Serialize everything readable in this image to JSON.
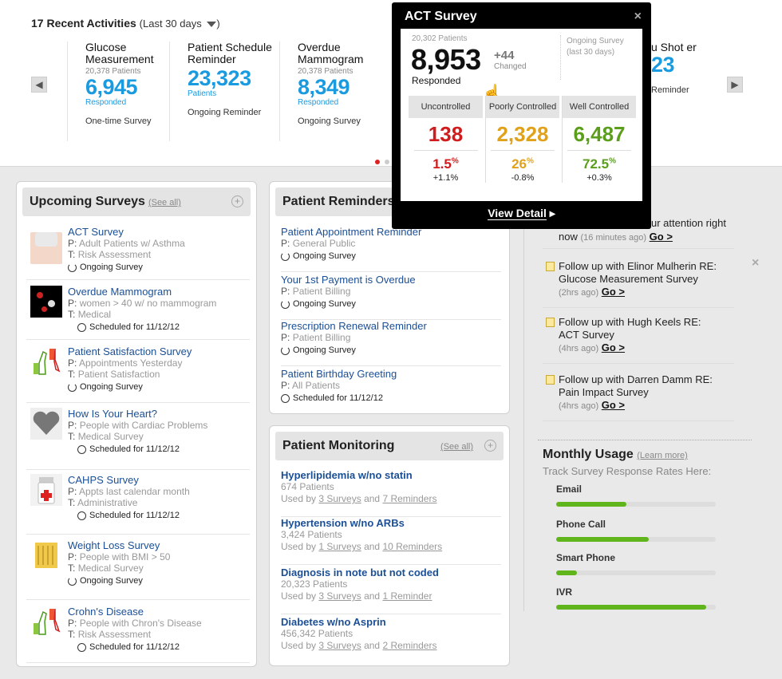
{
  "activities": {
    "title": "17 Recent Activities",
    "range": "(Last 30 days",
    "range_close": ")",
    "cards": [
      {
        "name": "Glucose Measurement",
        "patients": "20,378 Patients",
        "value": "6,945",
        "label": "Responded",
        "type": "One-time Survey"
      },
      {
        "name": "Patient Schedule Reminder",
        "patients": "",
        "value": "23,323",
        "label": "Patients",
        "type": "Ongoing Reminder"
      },
      {
        "name": "Overdue Mammogram",
        "patients": "20,378 Patients",
        "value": "8,349",
        "label": "Responded",
        "type": "Ongoing Survey"
      },
      {
        "name": "u Shot er",
        "patients": "",
        "value": "23",
        "label": "",
        "type": "Reminder"
      }
    ]
  },
  "popup": {
    "title": "ACT Survey",
    "close": "×",
    "patients": "20,302 Patients",
    "responded_value": "8,953",
    "responded_label": "Responded",
    "change": "+44",
    "change_label": "Changed",
    "survey_type": "Ongoing  Survey",
    "survey_range": "(last 30 days)",
    "columns": [
      {
        "header": "Uncontrolled",
        "value": "138",
        "pct": "1.5",
        "delta": "+1.1%",
        "color": "#d01c1c"
      },
      {
        "header": "Poorly Controlled",
        "value": "2,328",
        "pct": "26",
        "delta": "-0.8%",
        "color": "#e0a21a"
      },
      {
        "header": "Well Controlled",
        "value": "6,487",
        "pct": "72.5",
        "delta": "+0.3%",
        "color": "#5a9e1b"
      }
    ],
    "view_detail": "View Detail"
  },
  "upcoming": {
    "title": "Upcoming Surveys",
    "see_all": "(See all)",
    "items": [
      {
        "title": "ACT Survey",
        "p": "Adult Patients w/ Asthma",
        "t": "Risk Assessment",
        "status": "Ongoing Survey"
      },
      {
        "title": "Overdue Mammogram",
        "p": "women > 40 w/ no mammogram",
        "t": "Medical",
        "status": "Scheduled for 11/12/12"
      },
      {
        "title": "Patient Satisfaction Survey",
        "p": "Appointments Yesterday",
        "t": "Patient Satisfaction",
        "status": "Ongoing Survey"
      },
      {
        "title": "How Is Your Heart?",
        "p": "People with Cardiac Problems",
        "t": "Medical Survey",
        "status": "Scheduled for 11/12/12"
      },
      {
        "title": "CAHPS Survey",
        "p": "Appts last calendar month",
        "t": "Administrative",
        "status": "Scheduled for 11/12/12"
      },
      {
        "title": "Weight Loss Survey",
        "p": "People with BMI > 50",
        "t": "Medical Survey",
        "status": "Ongoing Survey"
      },
      {
        "title": "Crohn's Disease",
        "p": "People with Chron's Disease",
        "t": "Risk Assessment",
        "status": "Scheduled for 11/12/12"
      }
    ]
  },
  "reminders": {
    "title": "Patient Reminders",
    "items": [
      {
        "title": "Patient Appointment Reminder",
        "p": "General Public",
        "status": "Ongoing Survey"
      },
      {
        "title": "Your 1st Payment is Overdue",
        "p": "Patient Billing",
        "status": "Ongoing Survey"
      },
      {
        "title": "Prescription Renewal Reminder",
        "p": "Patient Billing",
        "status": "Ongoing Survey"
      },
      {
        "title": "Patient Birthday Greeting",
        "p": "All Patients",
        "status": "Scheduled for 11/12/12"
      }
    ]
  },
  "monitoring": {
    "title": "Patient Monitoring",
    "see_all": "(See all)",
    "items": [
      {
        "title": "Hyperlipidemia w/no statin",
        "count": "674 Patients",
        "surveys": "3 Surveys",
        "reminders": "7 Reminders"
      },
      {
        "title": "Hypertension w/no ARBs",
        "count": "3,424 Patients",
        "surveys": "1 Surveys",
        "reminders": "10 Reminders"
      },
      {
        "title": "Diagnosis in note but not coded",
        "count": "20,323 Patients",
        "surveys": "3 Surveys",
        "reminders": "1 Reminder"
      },
      {
        "title": "Diabetes w/no Asprin",
        "count": "456,342 Patients",
        "surveys": "3 Surveys",
        "reminders": "2 Reminders"
      }
    ],
    "used_by": "Used by",
    "and": "and"
  },
  "tasks": {
    "first": {
      "line1": "ur attention right",
      "line2": "now",
      "ago": "(16 minutes ago)",
      "go": "Go >"
    },
    "items": [
      {
        "line1": "Follow up with Elinor Mulherin RE:",
        "line2": "Glucose Measurement Survey",
        "ago": "(2hrs ago)",
        "go": "Go >"
      },
      {
        "line1": "Follow up with Hugh Keels RE:",
        "line2": "ACT Survey",
        "ago": "(4hrs ago)",
        "go": "Go >"
      },
      {
        "line1": "Follow up with Darren Damm RE:",
        "line2": "Pain Impact Survey",
        "ago": "(4hrs ago)",
        "go": "Go >"
      }
    ],
    "dismiss": "×"
  },
  "usage": {
    "title": "Monthly Usage",
    "learn_more": "(Learn more)",
    "subtitle": "Track Survey Response Rates Here:",
    "bars": [
      {
        "label": "Email",
        "value": 0.44
      },
      {
        "label": "Phone Call",
        "value": 0.58
      },
      {
        "label": "Smart Phone",
        "value": 0.13
      },
      {
        "label": "IVR",
        "value": 0.94
      }
    ]
  }
}
